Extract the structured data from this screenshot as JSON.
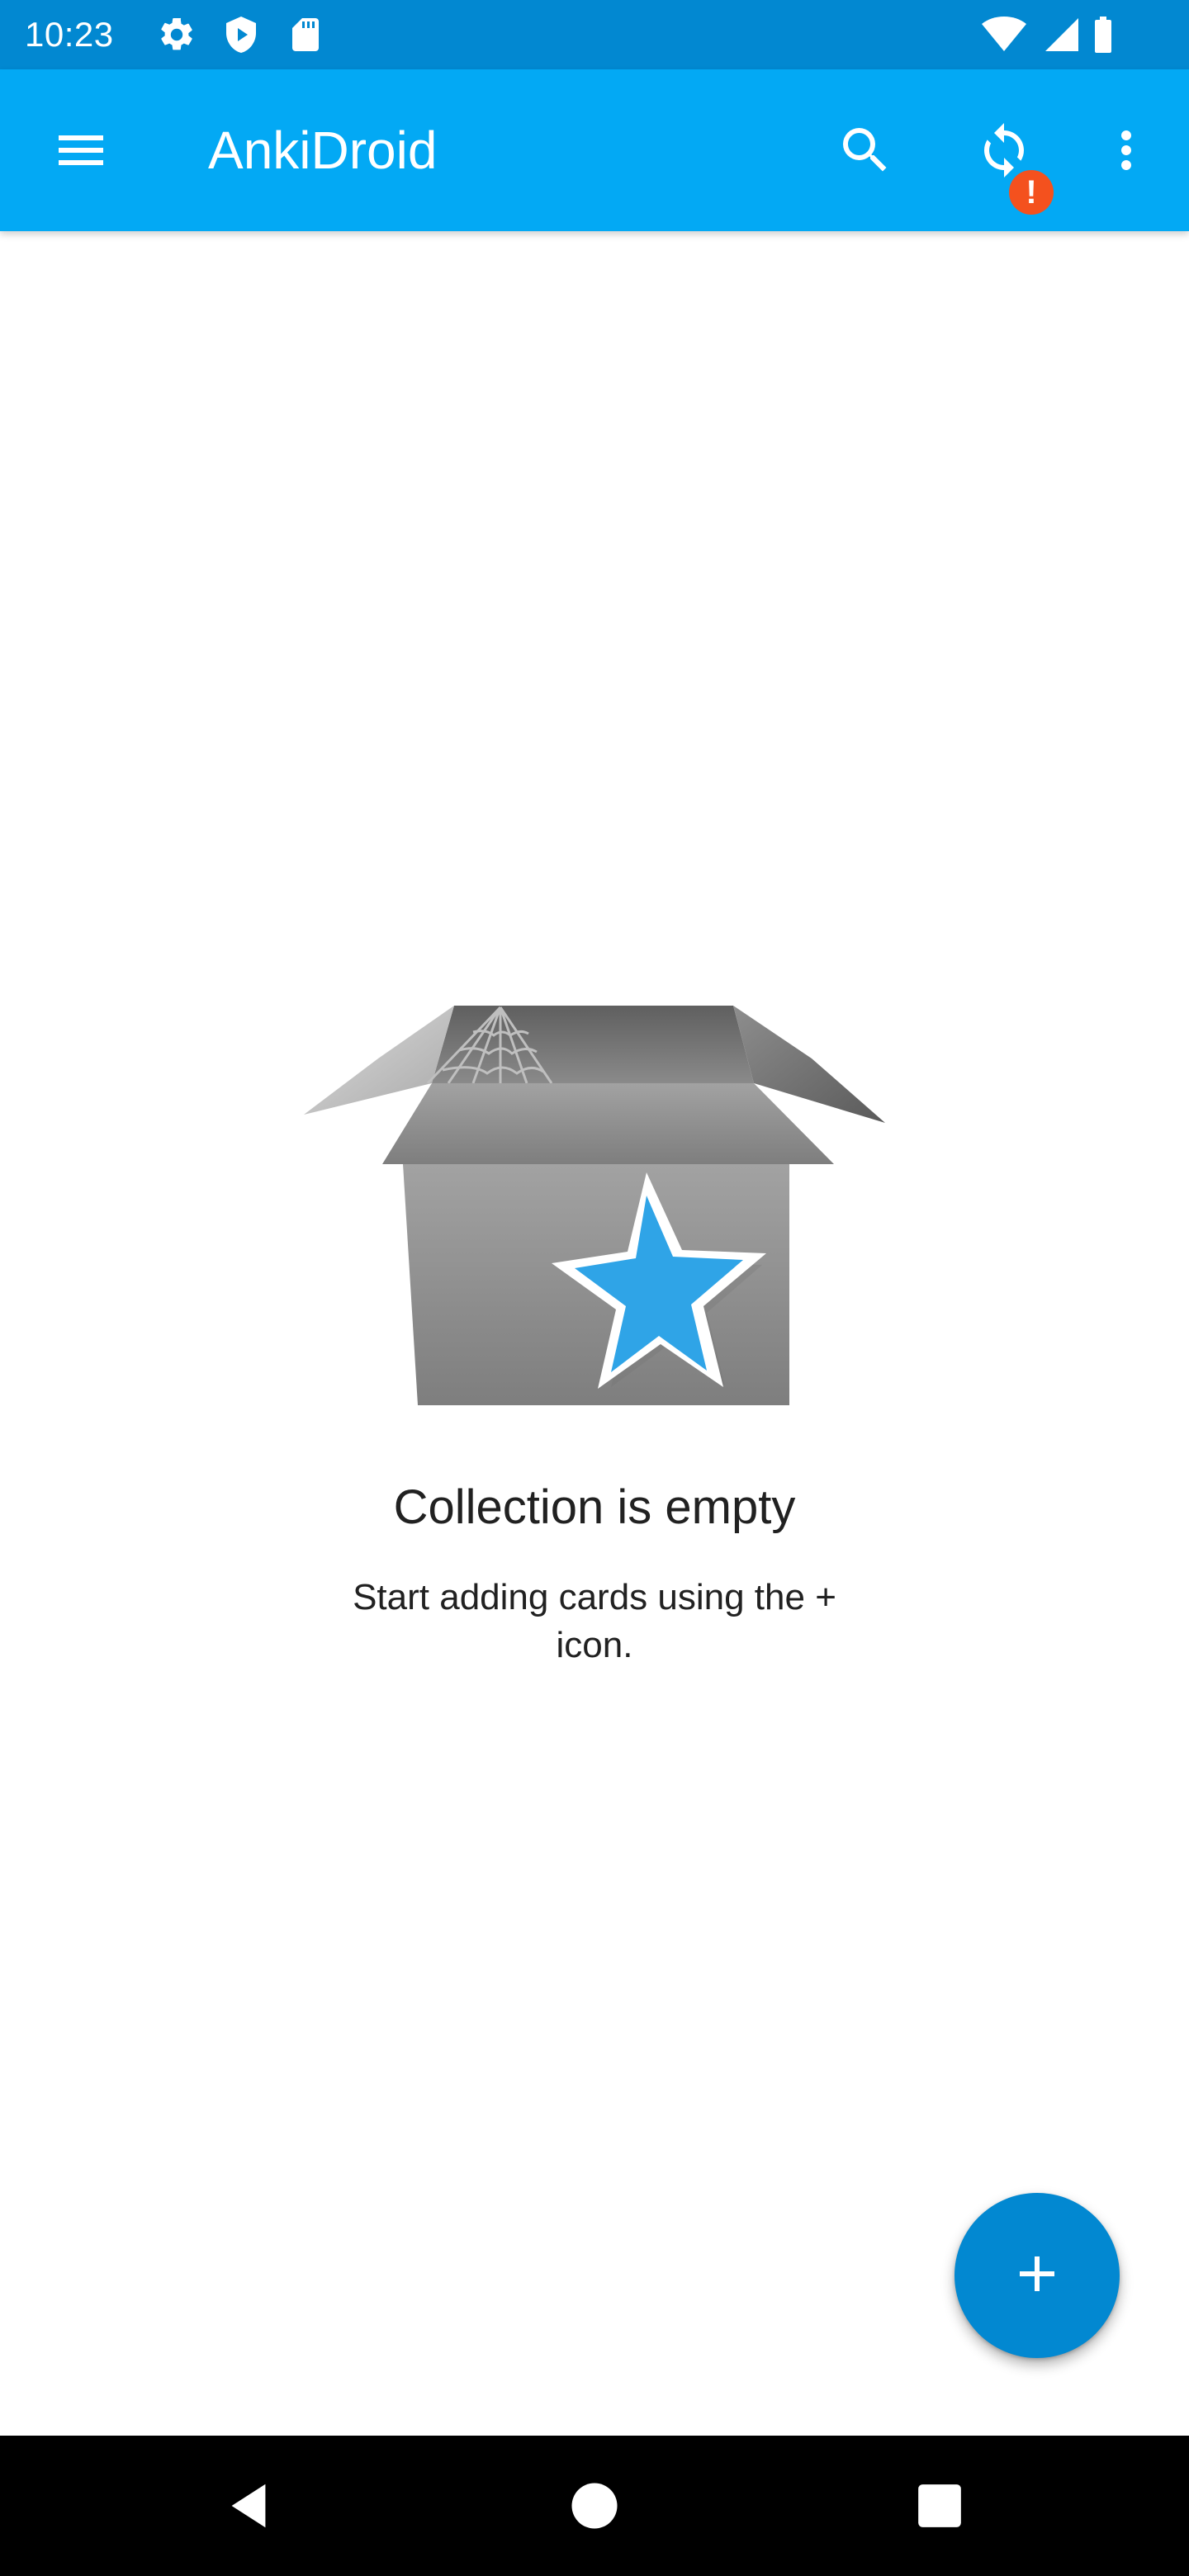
{
  "status_bar": {
    "time": "10:23",
    "left_icons": [
      "gear-icon",
      "shield-play-icon",
      "sd-card-icon"
    ],
    "right_icons": [
      "wifi-icon",
      "signal-icon",
      "battery-icon"
    ]
  },
  "app_bar": {
    "title": "AnkiDroid",
    "menu_icon": "hamburger-menu-icon",
    "actions": [
      "search-icon",
      "sync-icon",
      "overflow-menu-icon"
    ],
    "sync_badge": "!"
  },
  "empty_state": {
    "illustration": "open-box-with-star-icon",
    "title": "Collection is empty",
    "subtitle": "Start adding cards using the + icon."
  },
  "fab": {
    "icon": "plus-icon"
  },
  "nav_bar": {
    "buttons": [
      "back-icon",
      "home-icon",
      "recents-icon"
    ]
  },
  "colors": {
    "status_bar": "#0288d1",
    "app_bar": "#03a9f4",
    "fab": "#0288d1",
    "badge": "#f4511e",
    "star": "#2fa4e7",
    "background": "#ffffff"
  }
}
